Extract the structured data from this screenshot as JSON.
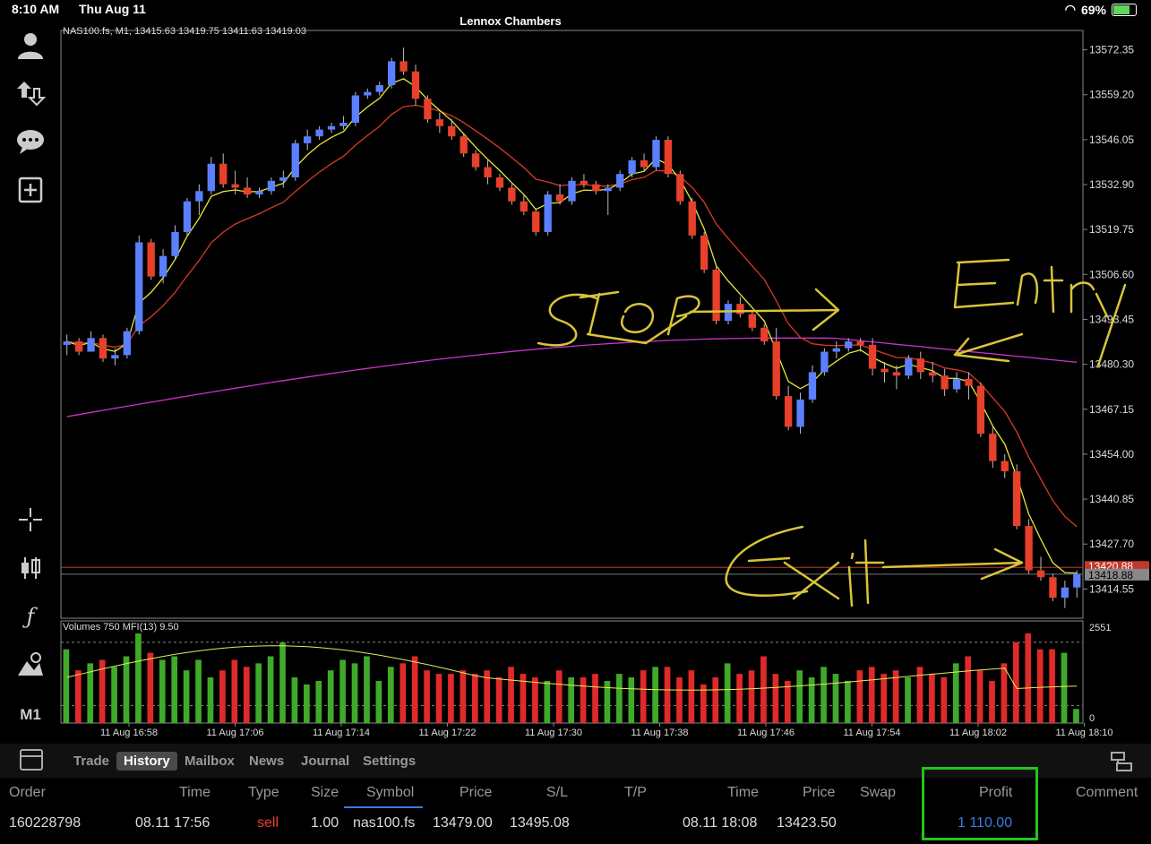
{
  "status_bar": {
    "time": "8:10 AM",
    "date": "Thu Aug 11",
    "account_name": "Lennox Chambers",
    "battery": "69%"
  },
  "left_toolbar": {
    "timeframe": "M1",
    "icons": [
      "account-icon",
      "trade-icon",
      "chat-icon",
      "new-order-icon",
      "crosshair-icon",
      "chart-type-icon",
      "indicators-icon",
      "objects-icon"
    ]
  },
  "chart": {
    "header": "NAS100.fs, M1, 13415.63 13419.75 13411.63 13419.03",
    "price_ticks": [
      "13572.35",
      "13559.20",
      "13546.05",
      "13532.90",
      "13519.75",
      "13506.60",
      "13493.45",
      "13480.30",
      "13467.15",
      "13454.00",
      "13440.85",
      "13427.70",
      "13414.55"
    ],
    "current_price": "13418.88",
    "red_line_label": "13420.88",
    "volume_header": "Volumes 750 MFI(13) 9.50",
    "volume_scale_top": "2551",
    "volume_scale_bottom": "0",
    "time_ticks": [
      "11 Aug 16:58",
      "11 Aug 17:06",
      "11 Aug 17:14",
      "11 Aug 17:22",
      "11 Aug 17:30",
      "11 Aug 17:38",
      "11 Aug 17:46",
      "11 Aug 17:54",
      "11 Aug 18:02",
      "11 Aug 18:10"
    ],
    "colors": {
      "bull": "#5a7fff",
      "bear": "#e8402a",
      "ma_fast": "#e8e83a",
      "ma_slow": "#d63a2a",
      "ma_long": "#cc33cc",
      "vol_up": "#3faa2a",
      "vol_down": "#e02a2a"
    },
    "candles_ohlc": [
      [
        13486,
        13489,
        13483,
        13487
      ],
      [
        13487,
        13488,
        13483,
        13484
      ],
      [
        13484,
        13490,
        13484,
        13488
      ],
      [
        13488,
        13489,
        13481,
        13482
      ],
      [
        13482,
        13485,
        13480,
        13483
      ],
      [
        13483,
        13491,
        13482,
        13490
      ],
      [
        13490,
        13518,
        13489,
        13516
      ],
      [
        13516,
        13517,
        13505,
        13506
      ],
      [
        13506,
        13514,
        13504,
        13512
      ],
      [
        13512,
        13521,
        13511,
        13519
      ],
      [
        13519,
        13529,
        13518,
        13528
      ],
      [
        13528,
        13533,
        13524,
        13531
      ],
      [
        13531,
        13541,
        13530,
        13539
      ],
      [
        13539,
        13542,
        13532,
        13533
      ],
      [
        13533,
        13537,
        13530,
        13532
      ],
      [
        13532,
        13535,
        13529,
        13530
      ],
      [
        13530,
        13532,
        13529,
        13531
      ],
      [
        13531,
        13535,
        13530,
        13534
      ],
      [
        13534,
        13537,
        13532,
        13535
      ],
      [
        13535,
        13546,
        13534,
        13545
      ],
      [
        13545,
        13549,
        13543,
        13547
      ],
      [
        13547,
        13550,
        13546,
        13549
      ],
      [
        13549,
        13551,
        13548,
        13550
      ],
      [
        13550,
        13553,
        13549,
        13551
      ],
      [
        13551,
        13560,
        13550,
        13559
      ],
      [
        13559,
        13561,
        13558,
        13560
      ],
      [
        13560,
        13563,
        13559,
        13562
      ],
      [
        13562,
        13570,
        13561,
        13569
      ],
      [
        13569,
        13573,
        13565,
        13566
      ],
      [
        13566,
        13568,
        13556,
        13558
      ],
      [
        13558,
        13559,
        13551,
        13552
      ],
      [
        13552,
        13554,
        13548,
        13550
      ],
      [
        13550,
        13552,
        13546,
        13547
      ],
      [
        13547,
        13548,
        13541,
        13542
      ],
      [
        13542,
        13543,
        13537,
        13538
      ],
      [
        13538,
        13540,
        13533,
        13535
      ],
      [
        13535,
        13536,
        13531,
        13532
      ],
      [
        13532,
        13533,
        13527,
        13528
      ],
      [
        13528,
        13530,
        13524,
        13525
      ],
      [
        13525,
        13526,
        13518,
        13519
      ],
      [
        13519,
        13531,
        13518,
        13530
      ],
      [
        13530,
        13533,
        13527,
        13528
      ],
      [
        13528,
        13535,
        13527,
        13534
      ],
      [
        13534,
        13536,
        13532,
        13533
      ],
      [
        13533,
        13534,
        13530,
        13531
      ],
      [
        13531,
        13533,
        13524,
        13532
      ],
      [
        13532,
        13537,
        13531,
        13536
      ],
      [
        13536,
        13541,
        13535,
        13540
      ],
      [
        13540,
        13542,
        13537,
        13538
      ],
      [
        13538,
        13547,
        13537,
        13546
      ],
      [
        13546,
        13547,
        13535,
        13536
      ],
      [
        13536,
        13537,
        13527,
        13528
      ],
      [
        13528,
        13529,
        13517,
        13518
      ],
      [
        13518,
        13519,
        13507,
        13508
      ],
      [
        13508,
        13509,
        13492,
        13493
      ],
      [
        13493,
        13499,
        13492,
        13498
      ],
      [
        13498,
        13500,
        13494,
        13495
      ],
      [
        13495,
        13496,
        13490,
        13491
      ],
      [
        13491,
        13492,
        13486,
        13487
      ],
      [
        13487,
        13491,
        13470,
        13471
      ],
      [
        13471,
        13474,
        13461,
        13462
      ],
      [
        13462,
        13472,
        13460,
        13470
      ],
      [
        13470,
        13480,
        13469,
        13478
      ],
      [
        13478,
        13485,
        13477,
        13484
      ],
      [
        13484,
        13487,
        13482,
        13485
      ],
      [
        13485,
        13488,
        13484,
        13487
      ],
      [
        13487,
        13488,
        13484,
        13486
      ],
      [
        13486,
        13488,
        13477,
        13479
      ],
      [
        13479,
        13481,
        13475,
        13478
      ],
      [
        13478,
        13480,
        13473,
        13477
      ],
      [
        13477,
        13483,
        13476,
        13482
      ],
      [
        13482,
        13484,
        13476,
        13478
      ],
      [
        13478,
        13481,
        13475,
        13477
      ],
      [
        13477,
        13479,
        13471,
        13473
      ],
      [
        13473,
        13478,
        13472,
        13476
      ],
      [
        13476,
        13478,
        13470,
        13474
      ],
      [
        13474,
        13475,
        13459,
        13460
      ],
      [
        13460,
        13462,
        13450,
        13452
      ],
      [
        13452,
        13454,
        13447,
        13449
      ],
      [
        13449,
        13451,
        13432,
        13433
      ],
      [
        13433,
        13435,
        13419,
        13420
      ],
      [
        13420,
        13424,
        13417,
        13418
      ],
      [
        13418,
        13419,
        13411,
        13412
      ],
      [
        13412,
        13417,
        13409,
        13415
      ],
      [
        13415,
        13420,
        13412,
        13419
      ]
    ],
    "volumes": [
      2100,
      1500,
      1700,
      1800,
      1600,
      1900,
      2551,
      2000,
      1800,
      1900,
      1500,
      1800,
      1300,
      1500,
      1800,
      1600,
      1700,
      1900,
      2300,
      1300,
      1100,
      1200,
      1500,
      1800,
      1700,
      1900,
      1200,
      1600,
      1700,
      1900,
      1500,
      1400,
      1400,
      1500,
      1400,
      1500,
      1300,
      1600,
      1400,
      1300,
      1200,
      1500,
      1300,
      1300,
      1400,
      1200,
      1400,
      1300,
      1500,
      1600,
      1600,
      1300,
      1500,
      1100,
      1300,
      1700,
      1400,
      1500,
      1900,
      1400,
      1200,
      1500,
      1300,
      1600,
      1400,
      1200,
      1500,
      1600,
      1400,
      1500,
      1300,
      1600,
      1400,
      1300,
      1700,
      1900,
      1500,
      1200,
      1700,
      2300,
      2551,
      2100,
      2100,
      2000,
      400
    ]
  },
  "annotations": {
    "stop": "Stop",
    "entry": "Entry",
    "exit": "Exit"
  },
  "bottom_tabs": [
    "Trade",
    "History",
    "Mailbox",
    "News",
    "Journal",
    "Settings"
  ],
  "active_tab": "History",
  "history_columns": [
    "Order",
    "Time",
    "Type",
    "Size",
    "Symbol",
    "Price",
    "S/L",
    "T/P",
    "Time",
    "Price",
    "Swap",
    "Profit",
    "Comment"
  ],
  "history_rows": [
    {
      "order": "160228798",
      "open_time": "08.11 17:56",
      "type": "sell",
      "size": "1.00",
      "symbol": "nas100.fs",
      "open_price": "13479.00",
      "sl": "13495.08",
      "tp": "",
      "close_time": "08.11 18:08",
      "close_price": "13423.50",
      "swap": "",
      "profit": "1 110.00",
      "comment": ""
    }
  ]
}
